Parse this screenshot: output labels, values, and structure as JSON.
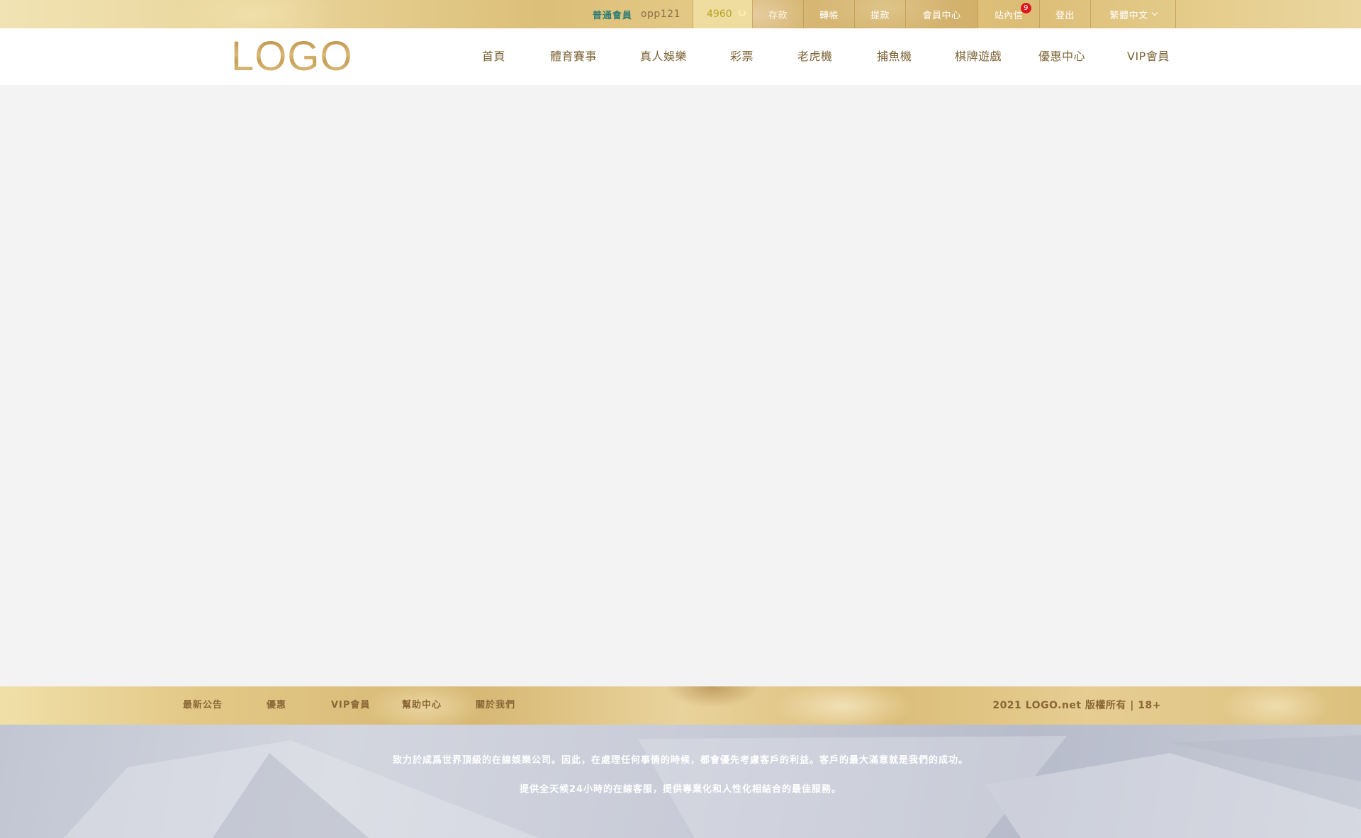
{
  "topbar": {
    "member_level": "普通會員",
    "member_name": "opp121",
    "balance": "4960",
    "links": {
      "deposit": "存款",
      "transfer": "轉帳",
      "withdraw": "提款",
      "member_center": "會員中心",
      "messages": "站內信",
      "logout": "登出",
      "language": "繁體中文"
    },
    "message_count": "9"
  },
  "header": {
    "logo": "LOGO",
    "nav": [
      {
        "label": "首頁"
      },
      {
        "label": "體育賽事"
      },
      {
        "label": "真人娛樂"
      },
      {
        "label": "彩票"
      },
      {
        "label": "老虎機"
      },
      {
        "label": "捕魚機"
      },
      {
        "label": "棋牌遊戲"
      },
      {
        "label": "優惠中心"
      },
      {
        "label": "VIP會員"
      }
    ]
  },
  "footer": {
    "links": [
      {
        "label": "最新公告"
      },
      {
        "label": "優惠"
      },
      {
        "label": "VIP會員"
      },
      {
        "label": "幫助中心"
      },
      {
        "label": "關於我們"
      }
    ],
    "copyright": "2021 LOGO.net 版權所有 | 18+",
    "lines": [
      "致力於成爲世界頂級的在線娛樂公司。因此，在處理任何事情的時候，都會優先考慮客戶的利益。客戶的最大滿意就是我們的成功。",
      "提供全天候24小時的在線客服，提供專業化和人性化相結合的最佳服務。"
    ]
  },
  "colors": {
    "gold_text": "#7d6436",
    "member_level": "#2c7d74",
    "badge": "#e1161d",
    "balance_text": "#b8a22a"
  }
}
